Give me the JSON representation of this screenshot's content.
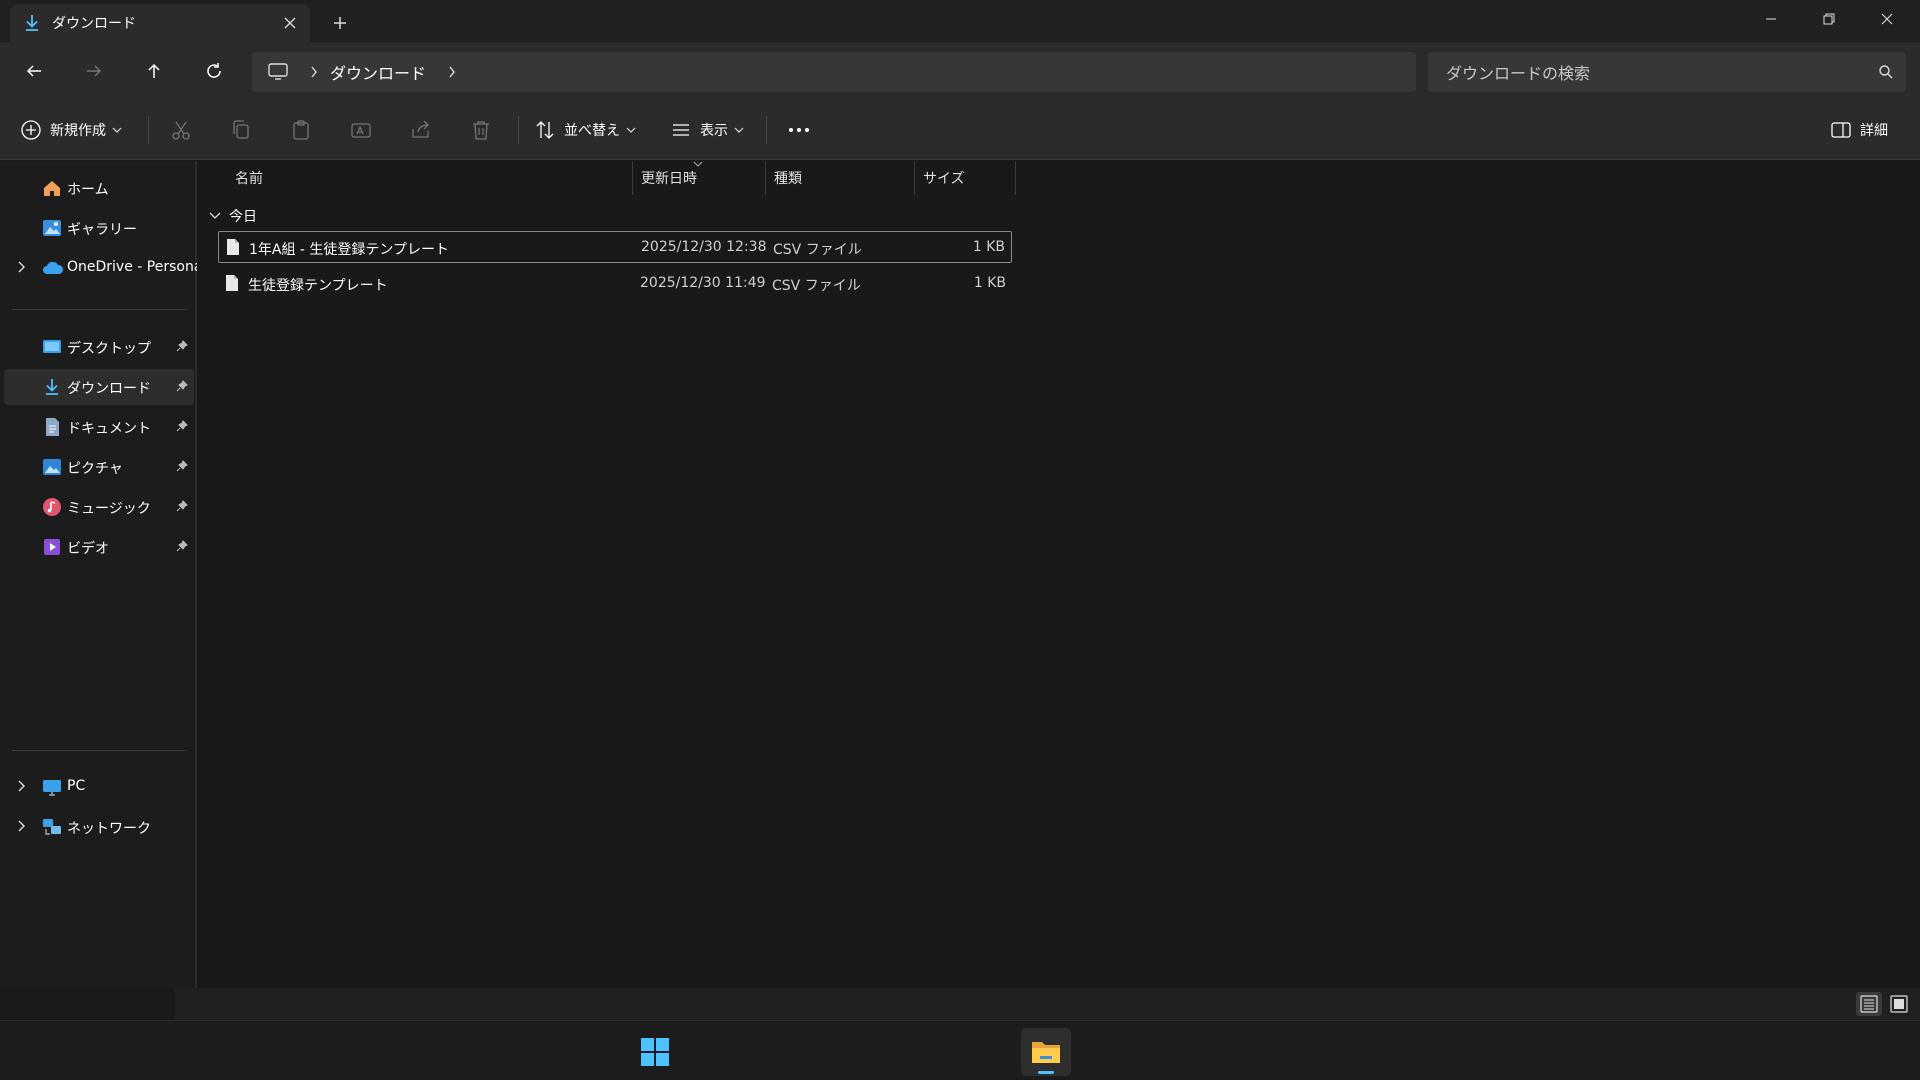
{
  "window": {
    "tab_title": "ダウンロード",
    "accent": "#60cdff"
  },
  "address": {
    "crumbs": [
      "ダウンロード"
    ],
    "search_placeholder": "ダウンロードの検索"
  },
  "commands": {
    "new": "新規作成",
    "sort": "並べ替え",
    "view": "表示",
    "details": "詳細"
  },
  "sidebar": {
    "items": [
      {
        "label": "ホーム",
        "icon": "home-icon"
      },
      {
        "label": "ギャラリー",
        "icon": "gallery-icon"
      },
      {
        "label": "OneDrive - Personal",
        "icon": "onedrive-icon"
      },
      {
        "label": "デスクトップ",
        "icon": "desktop-icon"
      },
      {
        "label": "ダウンロード",
        "icon": "download-icon"
      },
      {
        "label": "ドキュメント",
        "icon": "documents-icon"
      },
      {
        "label": "ピクチャ",
        "icon": "pictures-icon"
      },
      {
        "label": "ミュージック",
        "icon": "music-icon"
      },
      {
        "label": "ビデオ",
        "icon": "videos-icon"
      },
      {
        "label": "PC",
        "icon": "pc-icon"
      },
      {
        "label": "ネットワーク",
        "icon": "network-icon"
      }
    ]
  },
  "list": {
    "columns": [
      "名前",
      "更新日時",
      "種類",
      "サイズ"
    ],
    "group_label": "今日",
    "rows": [
      {
        "name": "1年A組 - 生徒登録テンプレート",
        "date": "2025/12/30 12:38",
        "type": "CSV ファイル",
        "size": "1 KB"
      },
      {
        "name": "生徒登録テンプレート",
        "date": "2025/12/30 11:49",
        "type": "CSV ファイル",
        "size": "1 KB"
      }
    ]
  }
}
